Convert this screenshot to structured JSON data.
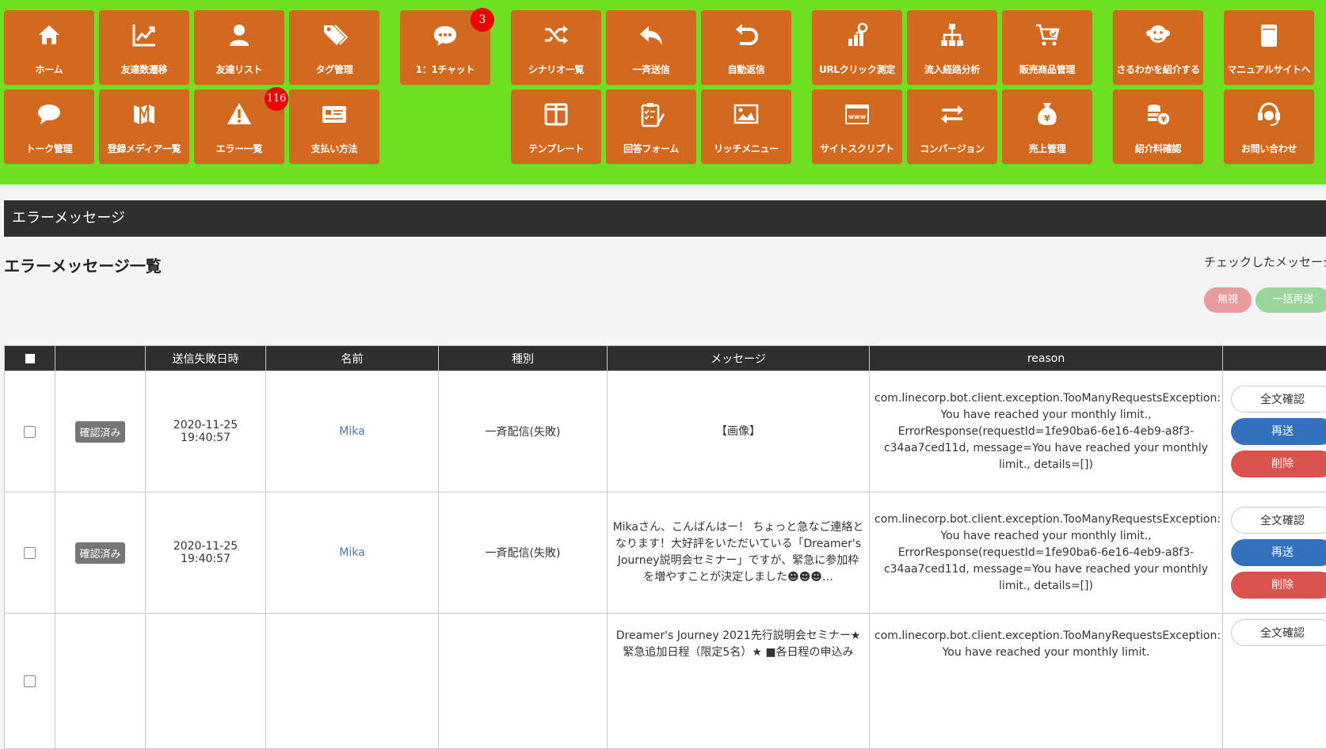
{
  "nav": {
    "items": [
      {
        "label": "ホーム",
        "icon": "home-icon"
      },
      {
        "label": "友達数遷移",
        "icon": "line-chart-icon"
      },
      {
        "label": "友達リスト",
        "icon": "user-icon"
      },
      {
        "label": "タグ管理",
        "icon": "tags-icon"
      },
      {
        "label": "1：1チャット",
        "icon": "chat-icon",
        "badge": "3"
      },
      {
        "label": "シナリオ一覧",
        "icon": "shuffle-icon"
      },
      {
        "label": "一斉送信",
        "icon": "reply-icon"
      },
      {
        "label": "自動返信",
        "icon": "undo-icon"
      },
      {
        "label": "URLクリック測定",
        "icon": "chart-search-icon"
      },
      {
        "label": "流入経路分析",
        "icon": "sitemap-icon"
      },
      {
        "label": "販売商品管理",
        "icon": "cart-icon"
      },
      {
        "label": "さるわかを紹介する",
        "icon": "monkey-icon"
      },
      {
        "label": "マニュアルサイトへ",
        "icon": "book-icon"
      },
      {
        "label": "トーク管理",
        "icon": "speech-bubble-icon"
      },
      {
        "label": "登録メディア一覧",
        "icon": "media-icon"
      },
      {
        "label": "エラー一覧",
        "icon": "warning-icon",
        "badge": "116"
      },
      {
        "label": "支払い方法",
        "icon": "card-icon"
      },
      {
        "label": "テンプレート",
        "icon": "columns-icon"
      },
      {
        "label": "回答フォーム",
        "icon": "clipboard-icon"
      },
      {
        "label": "リッチメニュー",
        "icon": "image-icon"
      },
      {
        "label": "サイトスクリプト",
        "icon": "www-icon"
      },
      {
        "label": "コンバージョン",
        "icon": "exchange-icon"
      },
      {
        "label": "売上管理",
        "icon": "money-bag-icon"
      },
      {
        "label": "紹介料確認",
        "icon": "coins-icon"
      },
      {
        "label": "お問い合わせ",
        "icon": "headset-icon"
      }
    ]
  },
  "page": {
    "title": "エラーメッセージ",
    "list_heading": "エラーメッセージ一覧",
    "checked_note": "チェックしたメッセージ",
    "ignore_label": "無視",
    "bulk_resend_label": "一括再送"
  },
  "table": {
    "headers": [
      "",
      "",
      "送信失敗日時",
      "名前",
      "種別",
      "メッセージ",
      "reason",
      ""
    ],
    "rows": [
      {
        "status": "確認済み",
        "date": "2020-11-25",
        "time": "19:40:57",
        "name": "Mika",
        "type": "一斉配信(失敗)",
        "message": "【画像】",
        "reason": "com.linecorp.bot.client.exception.TooManyRequestsException: You have reached your monthly limit., ErrorResponse(requestId=1fe90ba6-6e16-4eb9-a8f3-c34aa7ced11d, message=You have reached your monthly limit., details=[])",
        "btn_full": "全文確認",
        "btn_resend": "再送",
        "btn_delete": "削除"
      },
      {
        "status": "確認済み",
        "date": "2020-11-25",
        "time": "19:40:57",
        "name": "Mika",
        "type": "一斉配信(失敗)",
        "message": "Mikaさん、こんばんはー！ ちょっと急なご連絡となります！大好評をいただいている「Dreamer's Journey説明会セミナー」ですが、緊急に参加枠を増やすことが決定しました☻☻☻…",
        "reason": "com.linecorp.bot.client.exception.TooManyRequestsException: You have reached your monthly limit., ErrorResponse(requestId=1fe90ba6-6e16-4eb9-a8f3-c34aa7ced11d, message=You have reached your monthly limit., details=[])",
        "btn_full": "全文確認",
        "btn_resend": "再送",
        "btn_delete": "削除"
      },
      {
        "status": "",
        "date": "",
        "time": "",
        "name": "",
        "type": "",
        "message": "Dreamer's Journey 2021先行説明会セミナー★緊急追加日程（限定5名）★ ■各日程の申込み",
        "reason": "com.linecorp.bot.client.exception.TooManyRequestsException: You have reached your monthly limit.",
        "btn_full": "全文確認",
        "btn_resend": "",
        "btn_delete": ""
      }
    ]
  }
}
